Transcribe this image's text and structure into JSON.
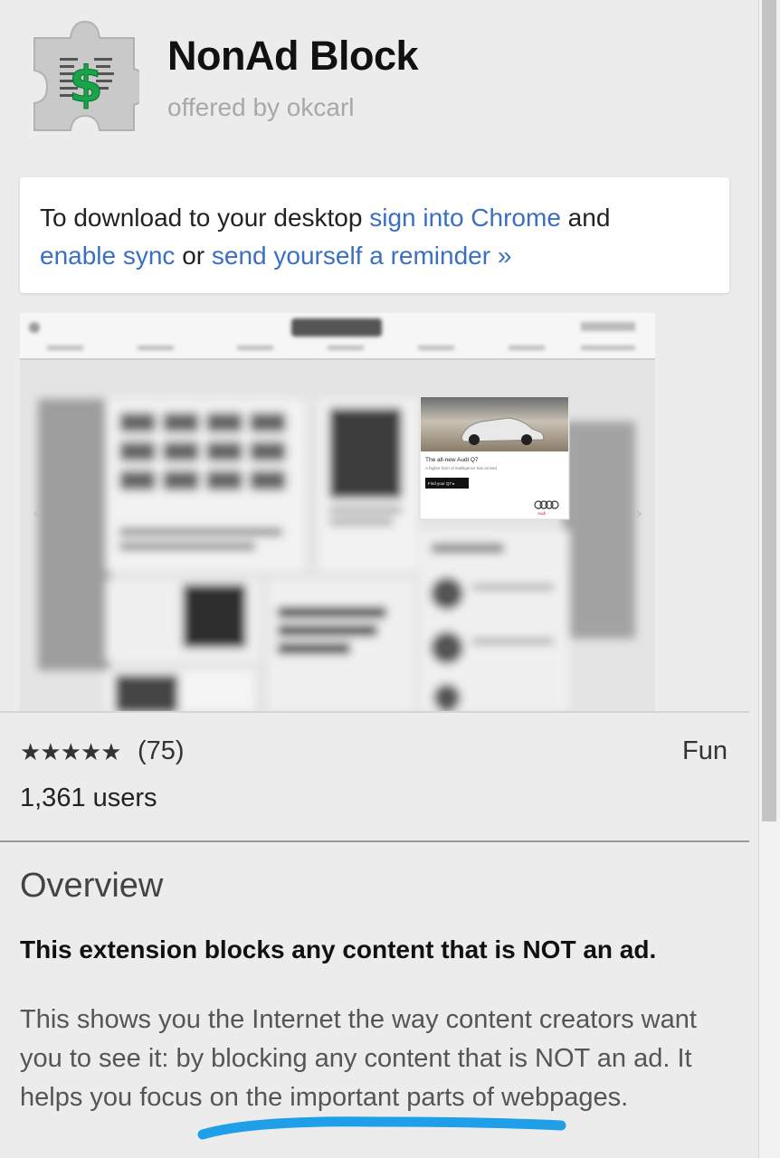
{
  "extension": {
    "name": "NonAd Block",
    "offered_by": "offered by okcarl"
  },
  "download_notice": {
    "prefix": "To download to your desktop ",
    "sign_in_link": "sign into Chrome",
    "middle": " and ",
    "sync_link": "enable sync",
    "or": " or ",
    "reminder_link": "send yourself a reminder »"
  },
  "screenshot_ad": {
    "headline": "The all-new Audi Q7",
    "subline": "A higher form of intelligence has arrived",
    "cta": "Find your Q7  ▸",
    "brand": "Audi"
  },
  "rating": {
    "stars": "★★★★★",
    "value": 4.5,
    "count": "(75)",
    "users": "1,361 users",
    "category": "Fun"
  },
  "overview": {
    "title": "Overview",
    "bold": "This extension blocks any content that is NOT an ad.",
    "description": "This shows you the Internet the way content creators want you to see it: by blocking any content that is NOT an ad. It helps you focus on the important parts of webpages."
  },
  "colors": {
    "link": "#3b6fc4",
    "highlight": "#1e9fe8",
    "logo_green": "#17a44a"
  }
}
